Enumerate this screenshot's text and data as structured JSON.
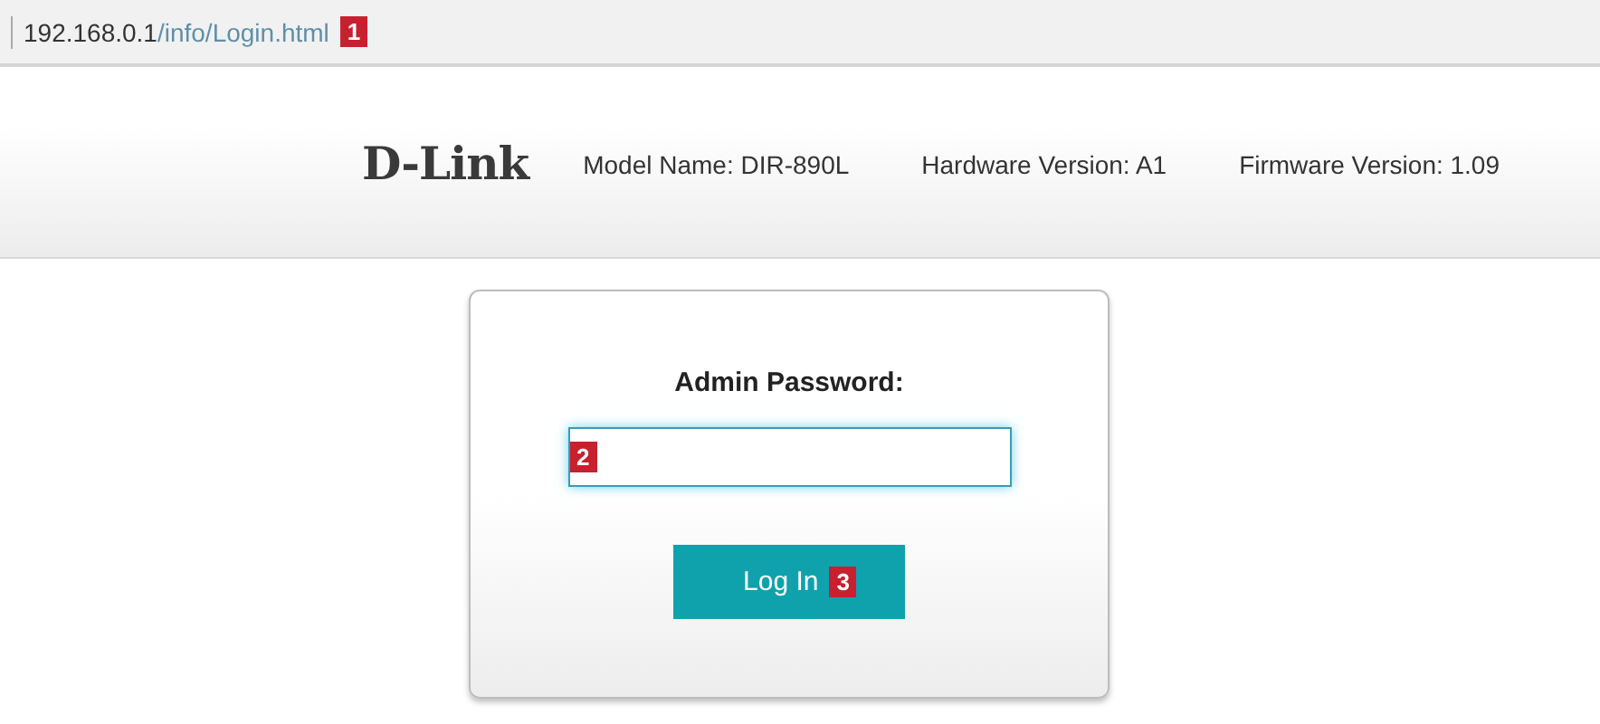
{
  "address_bar": {
    "host": "192.168.0.1",
    "path": "/info/Login.html",
    "callout": "1"
  },
  "header": {
    "logo": "D-Link",
    "model": "Model Name: DIR-890L",
    "hardware": "Hardware Version: A1",
    "firmware": "Firmware Version: 1.09"
  },
  "login": {
    "label": "Admin Password:",
    "field_callout": "2",
    "button": "Log In",
    "button_callout": "3"
  }
}
